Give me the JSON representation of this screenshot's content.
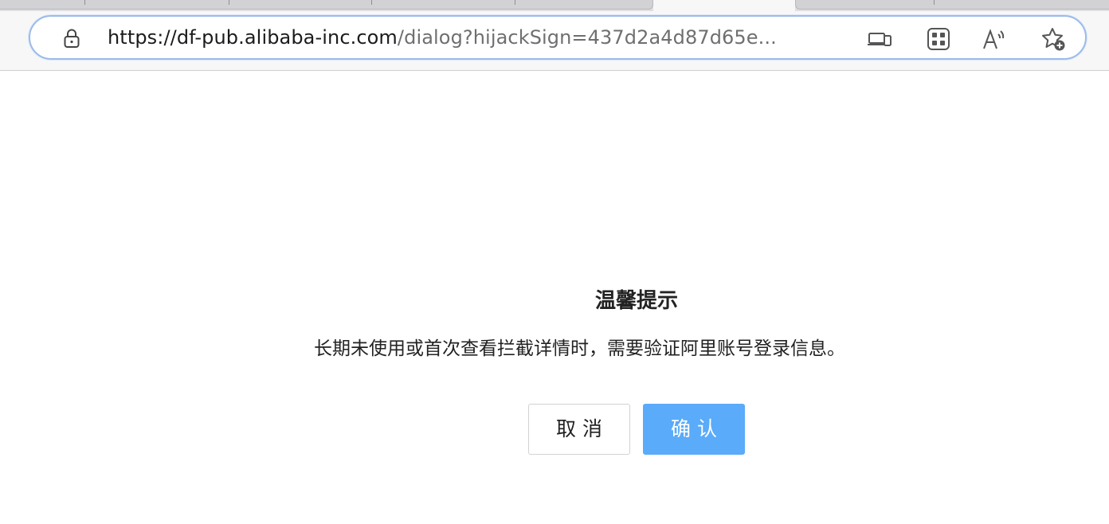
{
  "browser": {
    "url_host": "https://df-pub.alibaba-inc.com",
    "url_rest": "/dialog?hijackSign=437d2a4d87d65e...",
    "icons": {
      "lock": "lock-icon",
      "devices": "device-icon",
      "apps": "apps-grid-icon",
      "read_aloud": "read-aloud-icon",
      "favorites": "add-favorite-icon"
    }
  },
  "dialog": {
    "title": "温馨提示",
    "message": "长期未使用或首次查看拦截详情时，需要验证阿里账号登录信息。",
    "cancel_label": "取消",
    "confirm_label": "确认"
  },
  "colors": {
    "primary": "#5aabf9",
    "address_border": "#9dbbe9",
    "text": "#222222"
  }
}
